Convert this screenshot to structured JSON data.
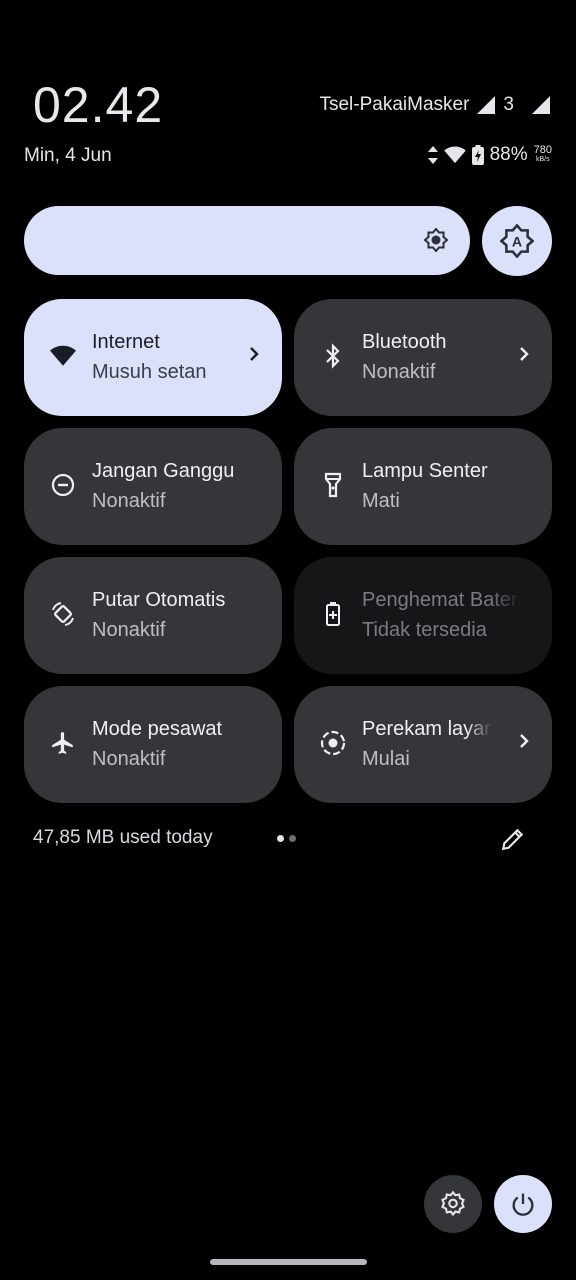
{
  "status_bar": {
    "time": "02.42",
    "date": "Min, 4 Jun",
    "carrier": "Tsel-PakaiMasker",
    "carrier_badge": "3",
    "battery": "88%",
    "netspeed_value": "780",
    "netspeed_unit": "kB/s"
  },
  "quick_settings": {
    "tiles": [
      {
        "label": "Internet",
        "sub": "Musuh setan",
        "icon": "wifi-icon",
        "active": true,
        "chevron": true
      },
      {
        "label": "Bluetooth",
        "sub": "Nonaktif",
        "icon": "bluetooth-icon",
        "active": false,
        "chevron": true
      },
      {
        "label": "Jangan Ganggu",
        "sub": "Nonaktif",
        "icon": "do-not-disturb-icon",
        "active": false,
        "chevron": false
      },
      {
        "label": "Lampu Senter",
        "sub": "Mati",
        "icon": "flashlight-icon",
        "active": false,
        "chevron": false
      },
      {
        "label": "Putar Otomatis",
        "sub": "Nonaktif",
        "icon": "auto-rotate-icon",
        "active": false,
        "chevron": false
      },
      {
        "label": "Penghemat Baterai",
        "sub": "Tidak tersedia",
        "icon": "battery-saver-icon",
        "active": false,
        "disabled": true,
        "chevron": false
      },
      {
        "label": "Mode pesawat",
        "sub": "Nonaktif",
        "icon": "airplane-icon",
        "active": false,
        "chevron": false
      },
      {
        "label": "Perekam layar",
        "sub": "Mulai",
        "icon": "screen-record-icon",
        "active": false,
        "chevron": true
      }
    ]
  },
  "footer": {
    "data_usage": "47,85 MB used today",
    "page_count": 2,
    "current_page": 1
  },
  "colors": {
    "accent": "#dbe1fb",
    "tile_bg": "#35363a",
    "background": "#000000"
  }
}
